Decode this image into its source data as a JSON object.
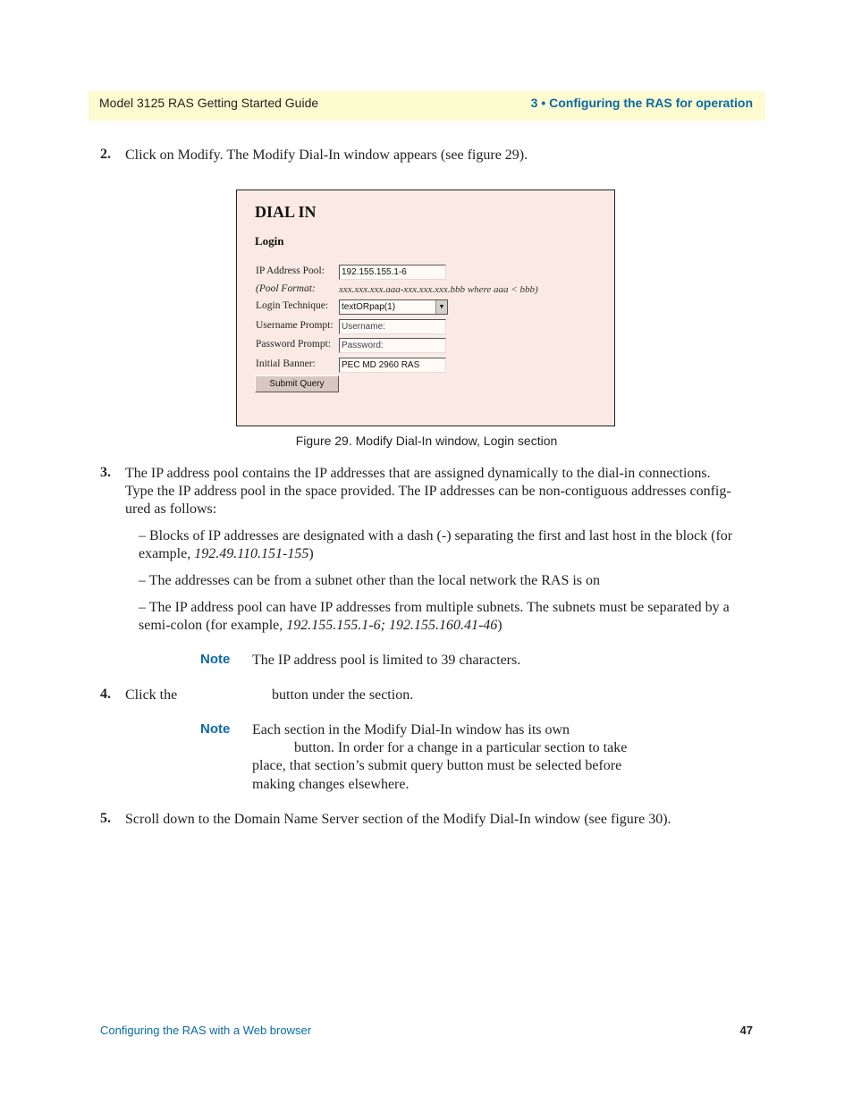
{
  "header": {
    "left": "Model 3125 RAS Getting Started Guide",
    "right": "3 • Configuring the RAS for operation"
  },
  "steps": {
    "step2": {
      "num": "2.",
      "text": "Click on Modify. The Modify Dial-In window appears (see figure 29)."
    },
    "step3": {
      "num": "3.",
      "lines": [
        "The IP address pool contains the IP addresses that are assigned dynamically to the dial-in connections.",
        "Type the IP address pool in the space provided. The IP addresses can be non-contiguous addresses config-",
        "ured as follows:"
      ]
    },
    "bullets": [
      {
        "line1": "– Blocks of IP addresses are designated with a dash (-) separating the first and last host in the block (for",
        "line2_prefix": "example, ",
        "line2_italic": "192.49.110.151-155",
        "line2_suffix": ")"
      },
      {
        "line1": "– The addresses can be from a subnet other than the local network the RAS is on"
      },
      {
        "line1": "– The IP address pool can have IP addresses from multiple subnets. The subnets must be separated by a",
        "line2_prefix": "semi-colon (for example, ",
        "line2_italic": "192.155.155.1-6; 192.155.160.41-46",
        "line2_suffix": ")"
      }
    ],
    "note1": {
      "label": "Note",
      "text": "The IP address pool is limited to 39 characters."
    },
    "step4": {
      "num": "4.",
      "text_before": "Click the",
      "text_after": "button under the section."
    },
    "note2": {
      "label": "Note",
      "lines": [
        "Each section in the Modify Dial-In window has its own",
        "button. In order for a change in a particular section to take",
        "place, that section’s submit query button must be selected before",
        "making changes elsewhere."
      ]
    },
    "step5": {
      "num": "5.",
      "text": "Scroll down to the Domain Name Server section of the Modify Dial-In window (see figure 30)."
    }
  },
  "figure": {
    "title": "DIAL IN",
    "section": "Login",
    "ip_pool_label": "IP Address Pool:",
    "ip_pool_value": "192.155.155.1-6",
    "pool_format_label": "(Pool Format:",
    "pool_format_text": "xxx.xxx.xxx.aaa-xxx.xxx.xxx.bbb where aaa < bbb)",
    "login_technique_label": "Login Technique:",
    "login_technique_value": "textORpap(1)",
    "username_label": "Username Prompt:",
    "username_value": "Username:",
    "password_label": "Password Prompt:",
    "password_value": "Password:",
    "banner_label": "Initial Banner:",
    "banner_value": "PEC MD 2960 RAS",
    "submit_label": "Submit Query",
    "caption": "Figure 29. Modify Dial-In window, Login section"
  },
  "footer": {
    "left": "Configuring the RAS with a Web browser",
    "page": "47"
  }
}
